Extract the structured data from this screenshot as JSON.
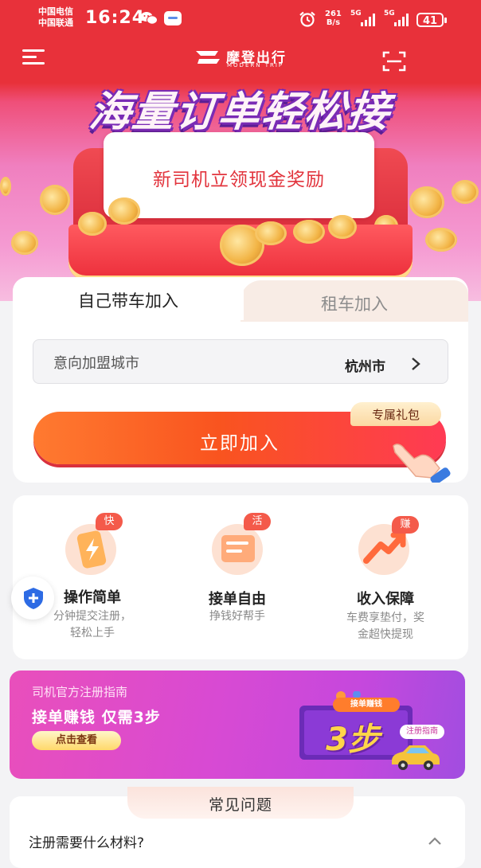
{
  "status_bar": {
    "carrier1": "中国电信",
    "carrier2": "中国联通",
    "time": "16:24",
    "net_speed_value": "261",
    "net_speed_unit": "B/s",
    "signal1": "5G",
    "signal2": "5G",
    "battery": "41"
  },
  "navbar": {
    "brand_cn": "摩登出行",
    "brand_en": "MODERN TRIP"
  },
  "hero": {
    "headline": "海量订单轻松接",
    "ticket_text": "新司机立领现金奖励"
  },
  "join_card": {
    "tabs": [
      {
        "label": "自己带车加入",
        "active": true
      },
      {
        "label": "租车加入",
        "active": false
      }
    ],
    "city_label": "意向加盟城市",
    "city_value": "杭州市",
    "join_button": "立即加入",
    "gift_badge": "专属礼包"
  },
  "features": [
    {
      "tag": "快",
      "title": "操作简单",
      "desc1": "分钟提交注册，",
      "desc2": "轻松上手",
      "icon": "lightning-phone-icon"
    },
    {
      "tag": "活",
      "title": "接单自由",
      "desc1": "挣钱好帮手",
      "desc2": "",
      "icon": "order-list-icon"
    },
    {
      "tag": "赚",
      "title": "收入保障",
      "desc1": "车费享垫付，奖",
      "desc2": "金超快提现",
      "icon": "income-arrow-icon"
    }
  ],
  "guide_banner": {
    "subtitle": "司机官方注册指南",
    "title": "接单赚钱 仅需3步",
    "button": "点击查看",
    "chip": "接单赚钱",
    "big_text": "3步",
    "tag": "注册指南"
  },
  "faq": {
    "title": "常见问题",
    "question": "注册需要什么材料?"
  },
  "colors": {
    "brand_red": "#e8313a",
    "accent_orange": "#f9541f",
    "tag_red": "#f45a4a"
  }
}
